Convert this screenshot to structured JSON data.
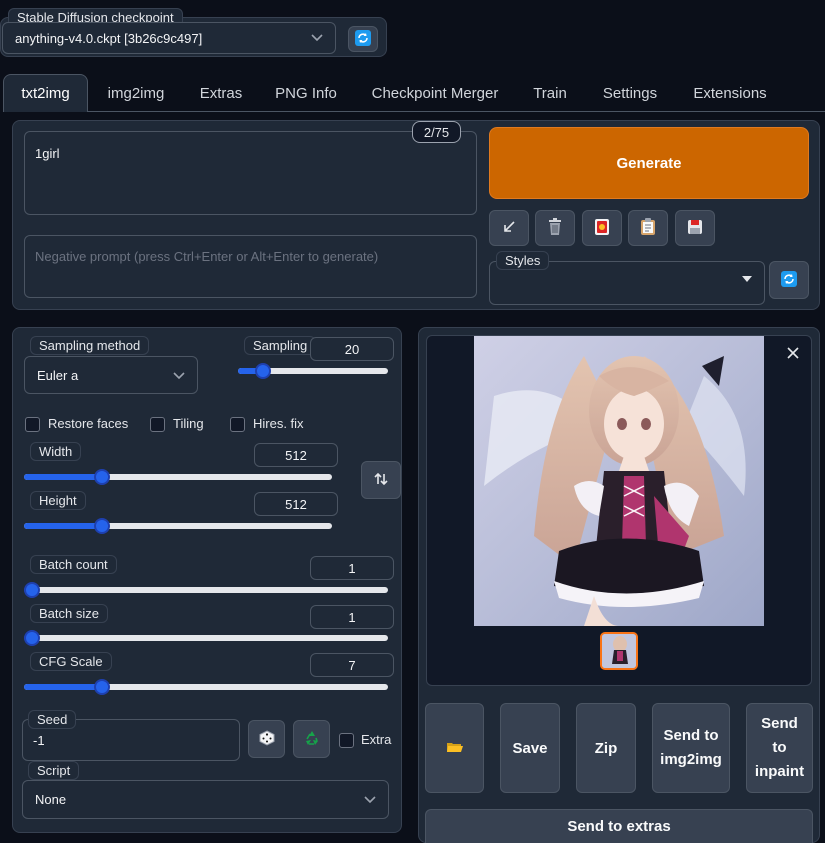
{
  "checkpoint": {
    "label": "Stable Diffusion checkpoint",
    "value": "anything-v4.0.ckpt [3b26c9c497]"
  },
  "tabs": [
    {
      "label": "txt2img",
      "active": true
    },
    {
      "label": "img2img"
    },
    {
      "label": "Extras"
    },
    {
      "label": "PNG Info"
    },
    {
      "label": "Checkpoint Merger"
    },
    {
      "label": "Train"
    },
    {
      "label": "Settings"
    },
    {
      "label": "Extensions"
    }
  ],
  "prompt": {
    "value": "1girl",
    "token_count": "2/75",
    "negative_placeholder": "Negative prompt (press Ctrl+Enter or Alt+Enter to generate)"
  },
  "generate": {
    "label": "Generate",
    "color": "#cc6600"
  },
  "styles": {
    "label": "Styles"
  },
  "sampling": {
    "method_label": "Sampling method",
    "method_value": "Euler a",
    "steps_label": "Sampling",
    "steps_value": "20",
    "steps_fraction": 0.13
  },
  "checkboxes": {
    "restore_faces": "Restore faces",
    "tiling": "Tiling",
    "hires_fix": "Hires. fix"
  },
  "width": {
    "label": "Width",
    "value": "512",
    "fraction": 0.24
  },
  "height": {
    "label": "Height",
    "value": "512",
    "fraction": 0.24
  },
  "batch_count": {
    "label": "Batch count",
    "value": "1",
    "fraction": 0.0
  },
  "batch_size": {
    "label": "Batch size",
    "value": "1",
    "fraction": 0.0
  },
  "cfg": {
    "label": "CFG Scale",
    "value": "7",
    "fraction": 0.2
  },
  "seed": {
    "label": "Seed",
    "value": "-1",
    "extra_label": "Extra"
  },
  "script": {
    "label": "Script",
    "value": "None"
  },
  "output_buttons": {
    "save": "Save",
    "zip": "Zip",
    "send_img2img": "Send to img2img",
    "send_inpaint": "Send to inpaint",
    "send_extras": "Send to extras"
  },
  "colors": {
    "accent_blue": "#2563eb",
    "generate_orange": "#cc6600"
  }
}
